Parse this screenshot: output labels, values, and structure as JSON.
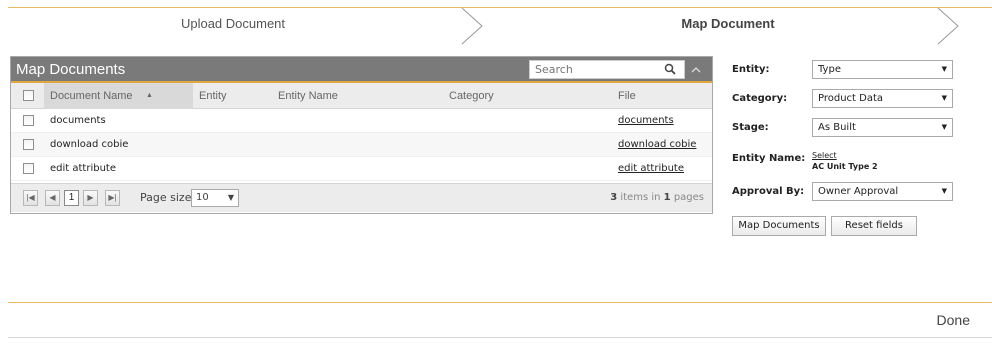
{
  "steps": {
    "upload_label": "Upload Document",
    "map_label": "Map Document"
  },
  "grid": {
    "title": "Map Documents",
    "search_placeholder": "Search",
    "columns": {
      "document_name": "Document Name",
      "entity": "Entity",
      "entity_name": "Entity Name",
      "category": "Category",
      "file": "File"
    },
    "rows": [
      {
        "document_name": "documents",
        "entity": "",
        "entity_name": "",
        "category": "",
        "file": "documents"
      },
      {
        "document_name": "download cobie",
        "entity": "",
        "entity_name": "",
        "category": "",
        "file": "download cobie"
      },
      {
        "document_name": "edit attribute",
        "entity": "",
        "entity_name": "",
        "category": "",
        "file": "edit attribute"
      }
    ],
    "pager": {
      "current_page": "1",
      "page_size_label": "Page size:",
      "page_size": "10",
      "items_count": "3",
      "items_text": "items in",
      "pages_count": "1",
      "pages_text": "pages"
    }
  },
  "form": {
    "entity_label": "Entity:",
    "entity_value": "Type",
    "category_label": "Category:",
    "category_value": "Product Data",
    "stage_label": "Stage:",
    "stage_value": "As Built",
    "entity_name_label": "Entity Name:",
    "entity_name_select": "Select",
    "entity_name_value": "AC Unit Type 2",
    "approval_label": "Approval By:",
    "approval_value": "Owner Approval",
    "map_button": "Map Documents",
    "reset_button": "Reset fields"
  },
  "footer": {
    "done_label": "Done"
  },
  "colors": {
    "accent": "#e0a640",
    "header_bg": "#7a7a7a"
  }
}
